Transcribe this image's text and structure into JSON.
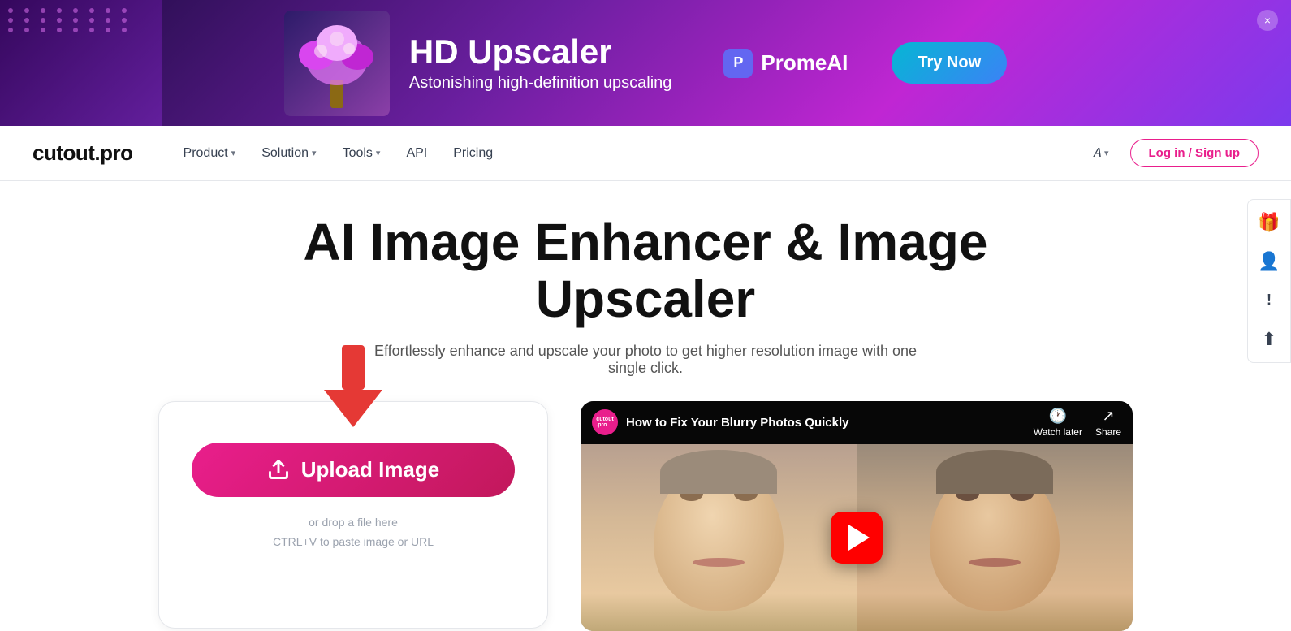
{
  "ad": {
    "title": "HD Upscaler",
    "subtitle": "Astonishing high-definition upscaling",
    "brand_name": "PromeAI",
    "try_button": "Try Now",
    "close_label": "×"
  },
  "navbar": {
    "logo": "cutout.pro",
    "nav_items": [
      {
        "label": "Product",
        "has_dropdown": true
      },
      {
        "label": "Solution",
        "has_dropdown": true
      },
      {
        "label": "Tools",
        "has_dropdown": true
      },
      {
        "label": "API",
        "has_dropdown": false
      },
      {
        "label": "Pricing",
        "has_dropdown": false
      }
    ],
    "lang_label": "A",
    "login_label": "Log in / Sign up"
  },
  "hero": {
    "title": "AI Image Enhancer & Image Upscaler",
    "subtitle": "Effortlessly enhance and upscale your photo to get higher resolution image with one single click."
  },
  "upload": {
    "button_label": "Upload Image",
    "hint_line1": "or drop a file here",
    "hint_line2": "CTRL+V to paste image or URL"
  },
  "video": {
    "title": "How to Fix Your Blurry Photos Quickly",
    "channel": "cutout.pro",
    "watch_later": "Watch later",
    "share": "Share"
  },
  "sidebar": {
    "items": [
      {
        "icon": "🎁",
        "label": "gift"
      },
      {
        "icon": "👤",
        "label": "user"
      },
      {
        "icon": "❕",
        "label": "info"
      },
      {
        "icon": "⬆",
        "label": "upload"
      }
    ]
  }
}
